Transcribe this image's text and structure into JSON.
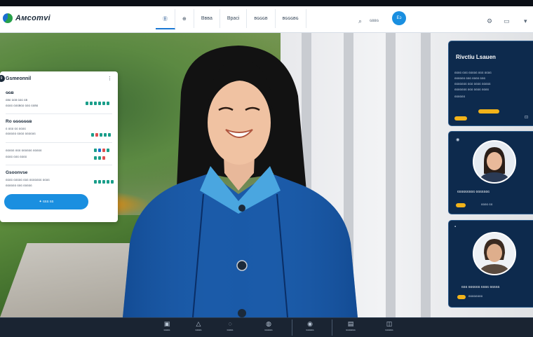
{
  "app": {
    "logo_text": "Aмcomvi"
  },
  "topbar": {
    "tabs": [
      {
        "label": "Ⓑ"
      },
      {
        "label": "⊕"
      },
      {
        "label": "Bʙʙa"
      },
      {
        "label": "Bpaci"
      },
      {
        "label": "ʙɢɢɢʙ"
      },
      {
        "label": "ʙɢɢɢʙɢ"
      }
    ],
    "search_label": "ɢʙʙɢ",
    "cta_label": "Eɔ"
  },
  "left_panel": {
    "badge": "9",
    "title": "Gsmeonnil",
    "sections": [
      {
        "heading": "ɢɢʙ",
        "rows": [
          "ɢʙɢ ɢɢʙ ɢɢɢ ɢʙ",
          "ɢɢɢɢ ɢɢɢʙɢɢ ɢɢɢ ɢɢʙɢ"
        ]
      },
      {
        "heading": "Ro ɢɢɢɢɢɢʙ",
        "rows": [
          "ɢ ɢɢɢ ɢɢ ɢɢɢɢ",
          "ɢɢɢɢɢɢ ɢɢɢɢ ɢɢɢɢɢɢ"
        ]
      },
      {
        "heading": "",
        "rows": [
          "ɢɢɢɢɢ ɢɢɢ ɢɢɢɢɢɢ ɢɢɢɢɢ",
          "ɢɢɢɢ ɢɢɢ ɢɢɢɢ"
        ]
      },
      {
        "heading": "Gsoonvse",
        "rows": [
          "ɢɢɢɢ ɢɢɢɢɢ ɢɢɢ ɢɢɢɢɢɢɢ ɢɢɢɢ",
          "ɢɢɢɢɢɢ ɢɢɢ ɢɢɢɢɢ"
        ]
      }
    ],
    "button_label": "✦ ɢɢɢ ɢɢ"
  },
  "cards": [
    {
      "title": "Rivctiu Lsauen",
      "lines": [
        "ɢɢɢɢ ɢɢɢ ɢɢɢɢɢ ɢɢɢ ɢɢɢɢ",
        "ɢɢɢɢɢɢ ɢɢɢ ɢɢɢɢ ɢɢɢ",
        "ɢɢɢɢɢɢɢ ɢɢɢ ɢɢɢɢ ɢɢɢɢɢ",
        "ɢɢɢɢɢɢɢ ɢɢɢ ɢɢɢɢ ɢɢɢɢ",
        "ɢɢɢɢɢɢ"
      ]
    },
    {
      "name": "ɢɢɢɢɢɢɢɢɢ ɢɢɢɢɢɢɢ",
      "sub": "ɢɢɢɢ ɢɢ"
    },
    {
      "name": "ɢɢɢ ɢɢɢɢɢɢ ɢɢɢɢ ɢɢɢɢɢ",
      "sub": "ɢɢɢɢɢɢɢɢ"
    }
  ],
  "bottombar": {
    "items": [
      {
        "icon": "▣",
        "label": "ɢɢɢɢ"
      },
      {
        "icon": "△",
        "label": "ɢɢɢɢ"
      },
      {
        "icon": "◌",
        "label": "ɢɢɢɢ"
      },
      {
        "icon": "◍",
        "label": "ɢɢɢɢɢ"
      },
      {
        "icon": "◉",
        "label": "ɢɢɢɢɢ"
      },
      {
        "icon": "▤",
        "label": "ɢɢɢɢɢɢ"
      },
      {
        "icon": "◫",
        "label": "ɢɢɢɢɢ"
      }
    ]
  },
  "colors": {
    "accent": "#1a8fe0",
    "card_bg": "#0d2a4d",
    "pill": "#f2b31a"
  }
}
